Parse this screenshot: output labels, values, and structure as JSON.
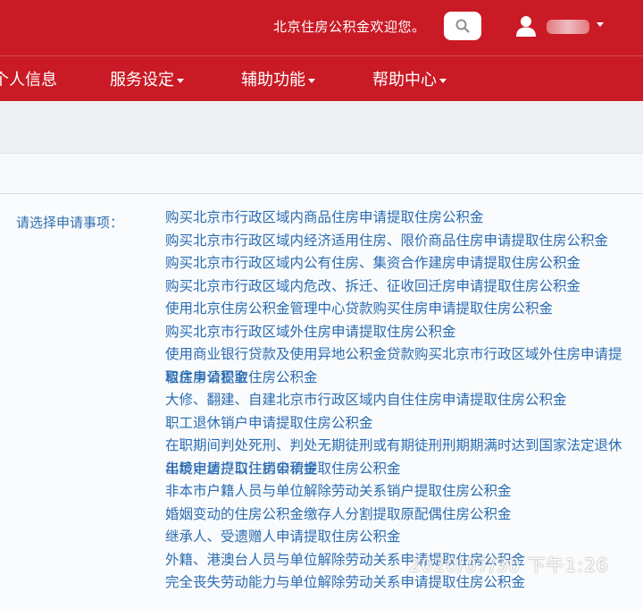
{
  "header": {
    "welcome_text": "北京住房公积金欢迎您。",
    "search_icon": "search-icon",
    "user_icon": "user-icon"
  },
  "nav": {
    "items": [
      {
        "label": "个人信息",
        "has_dropdown": false
      },
      {
        "label": "服务设定",
        "has_dropdown": true
      },
      {
        "label": "辅助功能",
        "has_dropdown": true
      },
      {
        "label": "帮助中心",
        "has_dropdown": true
      }
    ]
  },
  "main": {
    "select_label": "请选择申请事项：",
    "items": [
      "购买北京市行政区域内商品住房申请提取住房公积金",
      "购买北京市行政区域内经济适用住房、限价商品住房申请提取住房公积金",
      "购买北京市行政区域内公有住房、集资合作建房申请提取住房公积金",
      "购买北京市行政区域内危改、拆迁、征收回迁房申请提取住房公积金",
      "使用北京住房公积金管理中心贷款购买住房申请提取住房公积金",
      "购买北京市行政区域外住房申请提取住房公积金",
      "使用商业银行贷款及使用异地公积金贷款购买北京市行政区域外住房申请提取住房公积金",
      "租房申请提取住房公积金",
      "大修、翻建、自建北京市行政区域内自住住房申请提取住房公积金",
      "职工退休销户申请提取住房公积金",
      "在职期间判处死刑、判处无期徒刑或有期徒刑刑期期满时达到国家法定退休年龄申请提取住房公积金",
      "出境定居户口注销申请提取住房公积金",
      "非本市户籍人员与单位解除劳动关系销户提取住房公积金",
      "婚姻变动的住房公积金缴存人分割提取原配偶住房公积金",
      "继承人、受遗赠人申请提取住房公积金",
      "外籍、港澳台人员与单位解除劳动关系申请提取住房公积金",
      "完全丧失劳动能力与单位解除劳动关系申请提取住房公积金"
    ]
  },
  "watermark": "2020/07/30 下午1:26",
  "colors": {
    "brand_red": "#c91a25",
    "link_blue": "#2b6db3",
    "label_blue": "#2f6fb1"
  }
}
